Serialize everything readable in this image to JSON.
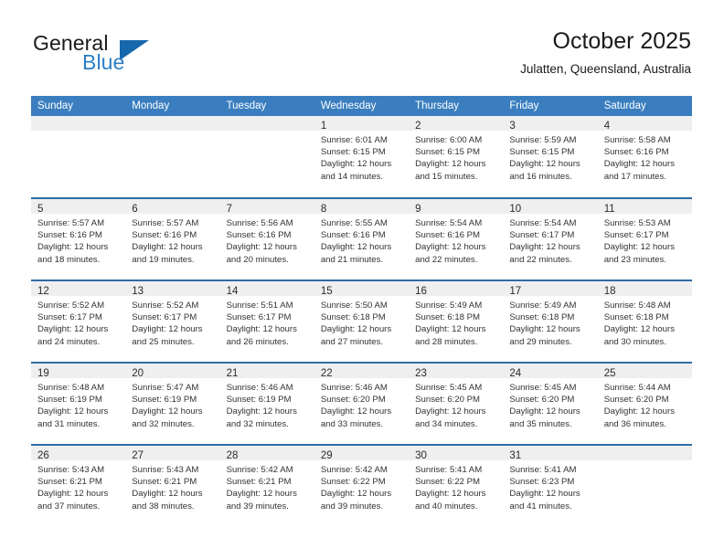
{
  "brand": {
    "name_part1": "General",
    "name_part2": "Blue",
    "triangle_color": "#1767ad",
    "blue_color": "#2b7fc4"
  },
  "header": {
    "title": "October 2025",
    "subtitle": "Julatten, Queensland, Australia",
    "header_bg": "#3a7ebf",
    "separator_color": "#2f6da4",
    "daynum_band_bg": "#efefef"
  },
  "weekday_headers": [
    "Sunday",
    "Monday",
    "Tuesday",
    "Wednesday",
    "Thursday",
    "Friday",
    "Saturday"
  ],
  "labels": {
    "sunrise_prefix": "Sunrise:",
    "sunset_prefix": "Sunset:",
    "daylight_prefix": "Daylight:"
  },
  "weeks": [
    [
      {
        "day": "",
        "empty": true
      },
      {
        "day": "",
        "empty": true
      },
      {
        "day": "",
        "empty": true
      },
      {
        "day": "1",
        "sunrise": "Sunrise: 6:01 AM",
        "sunset": "Sunset: 6:15 PM",
        "daylight1": "Daylight: 12 hours",
        "daylight2": "and 14 minutes."
      },
      {
        "day": "2",
        "sunrise": "Sunrise: 6:00 AM",
        "sunset": "Sunset: 6:15 PM",
        "daylight1": "Daylight: 12 hours",
        "daylight2": "and 15 minutes."
      },
      {
        "day": "3",
        "sunrise": "Sunrise: 5:59 AM",
        "sunset": "Sunset: 6:15 PM",
        "daylight1": "Daylight: 12 hours",
        "daylight2": "and 16 minutes."
      },
      {
        "day": "4",
        "sunrise": "Sunrise: 5:58 AM",
        "sunset": "Sunset: 6:16 PM",
        "daylight1": "Daylight: 12 hours",
        "daylight2": "and 17 minutes."
      }
    ],
    [
      {
        "day": "5",
        "sunrise": "Sunrise: 5:57 AM",
        "sunset": "Sunset: 6:16 PM",
        "daylight1": "Daylight: 12 hours",
        "daylight2": "and 18 minutes."
      },
      {
        "day": "6",
        "sunrise": "Sunrise: 5:57 AM",
        "sunset": "Sunset: 6:16 PM",
        "daylight1": "Daylight: 12 hours",
        "daylight2": "and 19 minutes."
      },
      {
        "day": "7",
        "sunrise": "Sunrise: 5:56 AM",
        "sunset": "Sunset: 6:16 PM",
        "daylight1": "Daylight: 12 hours",
        "daylight2": "and 20 minutes."
      },
      {
        "day": "8",
        "sunrise": "Sunrise: 5:55 AM",
        "sunset": "Sunset: 6:16 PM",
        "daylight1": "Daylight: 12 hours",
        "daylight2": "and 21 minutes."
      },
      {
        "day": "9",
        "sunrise": "Sunrise: 5:54 AM",
        "sunset": "Sunset: 6:16 PM",
        "daylight1": "Daylight: 12 hours",
        "daylight2": "and 22 minutes."
      },
      {
        "day": "10",
        "sunrise": "Sunrise: 5:54 AM",
        "sunset": "Sunset: 6:17 PM",
        "daylight1": "Daylight: 12 hours",
        "daylight2": "and 22 minutes."
      },
      {
        "day": "11",
        "sunrise": "Sunrise: 5:53 AM",
        "sunset": "Sunset: 6:17 PM",
        "daylight1": "Daylight: 12 hours",
        "daylight2": "and 23 minutes."
      }
    ],
    [
      {
        "day": "12",
        "sunrise": "Sunrise: 5:52 AM",
        "sunset": "Sunset: 6:17 PM",
        "daylight1": "Daylight: 12 hours",
        "daylight2": "and 24 minutes."
      },
      {
        "day": "13",
        "sunrise": "Sunrise: 5:52 AM",
        "sunset": "Sunset: 6:17 PM",
        "daylight1": "Daylight: 12 hours",
        "daylight2": "and 25 minutes."
      },
      {
        "day": "14",
        "sunrise": "Sunrise: 5:51 AM",
        "sunset": "Sunset: 6:17 PM",
        "daylight1": "Daylight: 12 hours",
        "daylight2": "and 26 minutes."
      },
      {
        "day": "15",
        "sunrise": "Sunrise: 5:50 AM",
        "sunset": "Sunset: 6:18 PM",
        "daylight1": "Daylight: 12 hours",
        "daylight2": "and 27 minutes."
      },
      {
        "day": "16",
        "sunrise": "Sunrise: 5:49 AM",
        "sunset": "Sunset: 6:18 PM",
        "daylight1": "Daylight: 12 hours",
        "daylight2": "and 28 minutes."
      },
      {
        "day": "17",
        "sunrise": "Sunrise: 5:49 AM",
        "sunset": "Sunset: 6:18 PM",
        "daylight1": "Daylight: 12 hours",
        "daylight2": "and 29 minutes."
      },
      {
        "day": "18",
        "sunrise": "Sunrise: 5:48 AM",
        "sunset": "Sunset: 6:18 PM",
        "daylight1": "Daylight: 12 hours",
        "daylight2": "and 30 minutes."
      }
    ],
    [
      {
        "day": "19",
        "sunrise": "Sunrise: 5:48 AM",
        "sunset": "Sunset: 6:19 PM",
        "daylight1": "Daylight: 12 hours",
        "daylight2": "and 31 minutes."
      },
      {
        "day": "20",
        "sunrise": "Sunrise: 5:47 AM",
        "sunset": "Sunset: 6:19 PM",
        "daylight1": "Daylight: 12 hours",
        "daylight2": "and 32 minutes."
      },
      {
        "day": "21",
        "sunrise": "Sunrise: 5:46 AM",
        "sunset": "Sunset: 6:19 PM",
        "daylight1": "Daylight: 12 hours",
        "daylight2": "and 32 minutes."
      },
      {
        "day": "22",
        "sunrise": "Sunrise: 5:46 AM",
        "sunset": "Sunset: 6:20 PM",
        "daylight1": "Daylight: 12 hours",
        "daylight2": "and 33 minutes."
      },
      {
        "day": "23",
        "sunrise": "Sunrise: 5:45 AM",
        "sunset": "Sunset: 6:20 PM",
        "daylight1": "Daylight: 12 hours",
        "daylight2": "and 34 minutes."
      },
      {
        "day": "24",
        "sunrise": "Sunrise: 5:45 AM",
        "sunset": "Sunset: 6:20 PM",
        "daylight1": "Daylight: 12 hours",
        "daylight2": "and 35 minutes."
      },
      {
        "day": "25",
        "sunrise": "Sunrise: 5:44 AM",
        "sunset": "Sunset: 6:20 PM",
        "daylight1": "Daylight: 12 hours",
        "daylight2": "and 36 minutes."
      }
    ],
    [
      {
        "day": "26",
        "sunrise": "Sunrise: 5:43 AM",
        "sunset": "Sunset: 6:21 PM",
        "daylight1": "Daylight: 12 hours",
        "daylight2": "and 37 minutes."
      },
      {
        "day": "27",
        "sunrise": "Sunrise: 5:43 AM",
        "sunset": "Sunset: 6:21 PM",
        "daylight1": "Daylight: 12 hours",
        "daylight2": "and 38 minutes."
      },
      {
        "day": "28",
        "sunrise": "Sunrise: 5:42 AM",
        "sunset": "Sunset: 6:21 PM",
        "daylight1": "Daylight: 12 hours",
        "daylight2": "and 39 minutes."
      },
      {
        "day": "29",
        "sunrise": "Sunrise: 5:42 AM",
        "sunset": "Sunset: 6:22 PM",
        "daylight1": "Daylight: 12 hours",
        "daylight2": "and 39 minutes."
      },
      {
        "day": "30",
        "sunrise": "Sunrise: 5:41 AM",
        "sunset": "Sunset: 6:22 PM",
        "daylight1": "Daylight: 12 hours",
        "daylight2": "and 40 minutes."
      },
      {
        "day": "31",
        "sunrise": "Sunrise: 5:41 AM",
        "sunset": "Sunset: 6:23 PM",
        "daylight1": "Daylight: 12 hours",
        "daylight2": "and 41 minutes."
      },
      {
        "day": "",
        "empty": true
      }
    ]
  ]
}
